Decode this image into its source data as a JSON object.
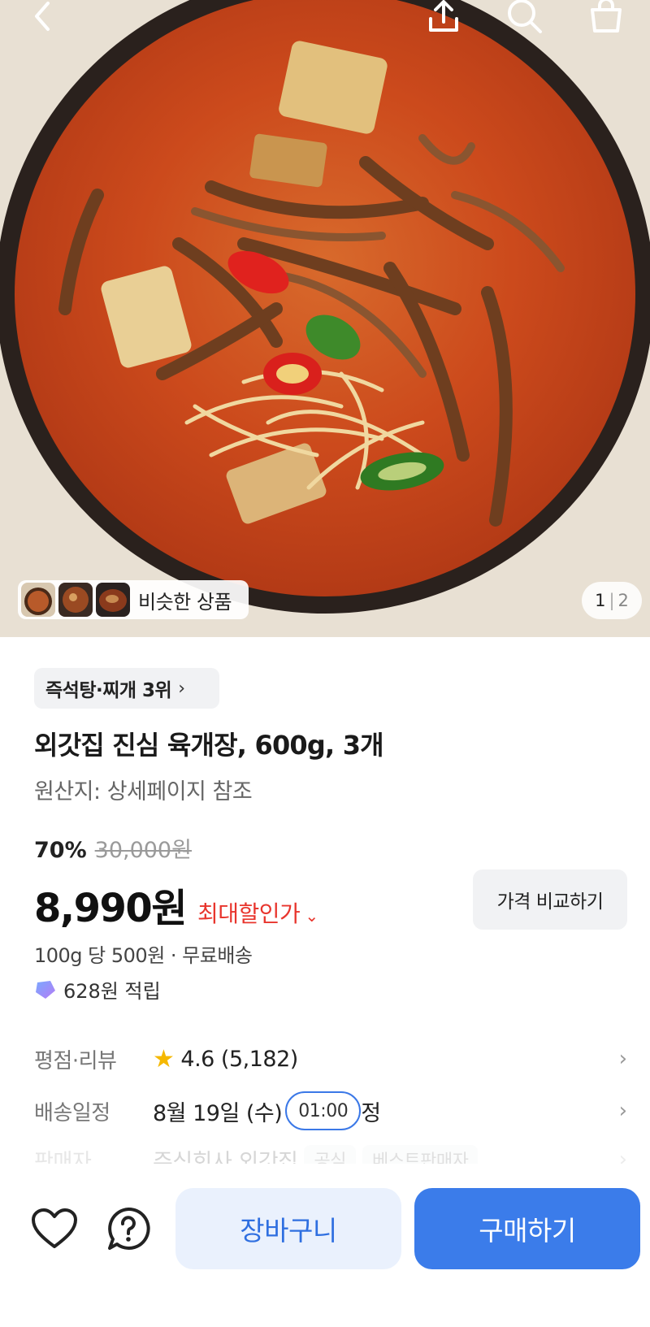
{
  "header": {
    "back_icon": "chevron-left-icon",
    "share_icon": "share-icon",
    "search_icon": "search-icon",
    "cart_icon": "shopping-bag-icon"
  },
  "gallery": {
    "similar_label": "비슷한 상품",
    "current_page": "1",
    "separator": "|",
    "total_pages": "2"
  },
  "product": {
    "rank_label": "즉석탕·찌개 3위",
    "title": "외갓집 진심 육개장, 600g, 3개",
    "origin": "원산지: 상세페이지 참조",
    "discount_rate": "70%",
    "original_price": "30,000원",
    "price": "8,990원",
    "max_discount_label": "최대할인가",
    "compare_button": "가격 비교하기",
    "unit_price": "100g 당 500원 · 무료배송",
    "points": "628원 적립"
  },
  "info": {
    "rating_label": "평점·리뷰",
    "rating_value": "4.6 (5,182)",
    "delivery_label": "배송일정",
    "delivery_value": "8월 19일 (수)",
    "delivery_suffix": "정",
    "delivery_time_badge": "01:00",
    "seller_label": "판매자",
    "seller_value": "주식회사 외갓집",
    "seller_tag_official": "공식",
    "seller_tag_best": "베스트판매자"
  },
  "bottom_bar": {
    "cart_button": "장바구니",
    "buy_button": "구매하기"
  },
  "colors": {
    "accent_blue": "#3b7cea",
    "discount_red": "#e8352d",
    "star_yellow": "#f5b800"
  }
}
